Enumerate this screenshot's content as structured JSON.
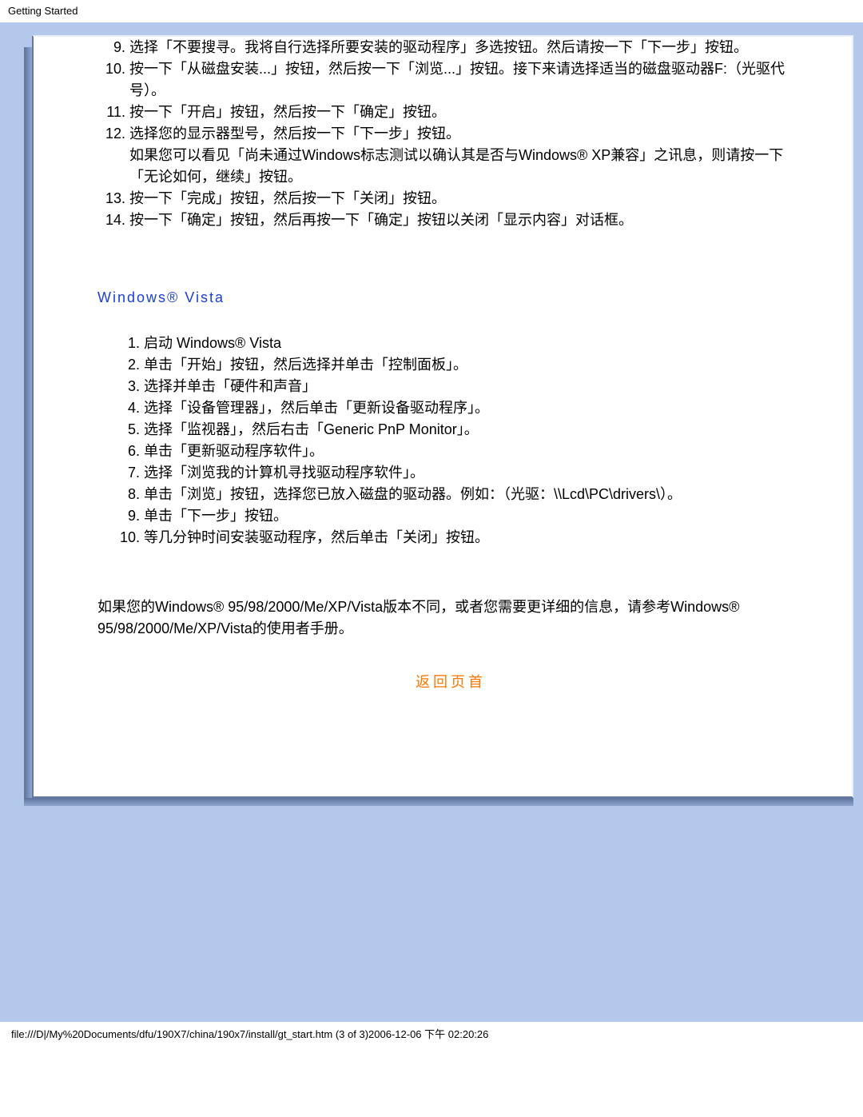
{
  "header": {
    "title": "Getting Started"
  },
  "xp_steps": {
    "s9": "选择「不要搜寻。我将自行选择所要安装的驱动程序」多选按钮。然后请按一下「下一步」按钮。",
    "s10": "按一下「从磁盘安装...」按钮，然后按一下「浏览...」按钮。接下来请选择适当的磁盘驱动器F:（光驱代号）。",
    "s11": "按一下「开启」按钮，然后按一下「确定」按钮。",
    "s12_a": "选择您的显示器型号，然后按一下「下一步」按钮。",
    "s12_b": "如果您可以看见「尚未通过Windows标志测试以确认其是否与Windows® XP兼容」之讯息，则请按一下「无论如何，继续」按钮。",
    "s13": "按一下「完成」按钮，然后按一下「关闭」按钮。",
    "s14": "按一下「确定」按钮，然后再按一下「确定」按钮以关闭「显示内容」对话框。"
  },
  "vista": {
    "heading": "Windows® Vista",
    "s1": "启动 Windows® Vista",
    "s2": "单击「开始」按钮，然后选择并单击「控制面板」。",
    "s3": "选择并单击「硬件和声音」",
    "s4": "选择「设备管理器」，然后单击「更新设备驱动程序」。",
    "s5": "选择「监视器」，然后右击「Generic PnP Monitor」。",
    "s6": "单击「更新驱动程序软件」。",
    "s7": "选择「浏览我的计算机寻找驱动程序软件」。",
    "s8": "单击「浏览」按钮，选择您已放入磁盘的驱动器。例如：（光驱：\\\\Lcd\\PC\\drivers\\）。",
    "s9": "单击「下一步」按钮。",
    "s10": "等几分钟时间安装驱动程序，然后单击「关闭」按钮。"
  },
  "note": "如果您的Windows® 95/98/2000/Me/XP/Vista版本不同，或者您需要更详细的信息，请参考Windows® 95/98/2000/Me/XP/Vista的使用者手册。",
  "back_link": "返回页首",
  "footer": "file:///D|/My%20Documents/dfu/190X7/china/190x7/install/gt_start.htm (3 of 3)2006-12-06 下午 02:20:26"
}
